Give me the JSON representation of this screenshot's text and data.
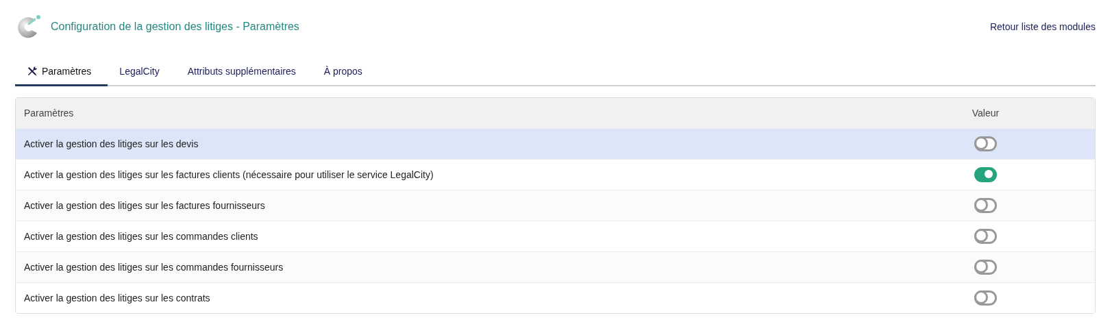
{
  "header": {
    "title": "Configuration de la gestion des litiges - Paramètres",
    "back_link": "Retour liste des modules"
  },
  "tabs": [
    {
      "label": "Paramètres",
      "selected": true,
      "kind": "tools"
    },
    {
      "label": "LegalCity",
      "selected": false,
      "kind": "plain"
    },
    {
      "label": "Attributs supplémentaires",
      "selected": false,
      "kind": "plain"
    },
    {
      "label": "À propos",
      "selected": false,
      "kind": "plain"
    }
  ],
  "table": {
    "columns": [
      "Paramètres",
      "Valeur"
    ],
    "rows": [
      {
        "label": "Activer la gestion des litiges sur les devis",
        "on": false,
        "highlighted": true
      },
      {
        "label": "Activer la gestion des litiges sur les factures clients (nécessaire pour utiliser le service LegalCity)",
        "on": true,
        "highlighted": false
      },
      {
        "label": "Activer la gestion des litiges sur les factures fournisseurs",
        "on": false,
        "highlighted": false
      },
      {
        "label": "Activer la gestion des litiges sur les commandes clients",
        "on": false,
        "highlighted": false
      },
      {
        "label": "Activer la gestion des litiges sur les commandes fournisseurs",
        "on": false,
        "highlighted": false
      },
      {
        "label": "Activer la gestion des litiges sur les contrats",
        "on": false,
        "highlighted": false
      }
    ]
  }
}
